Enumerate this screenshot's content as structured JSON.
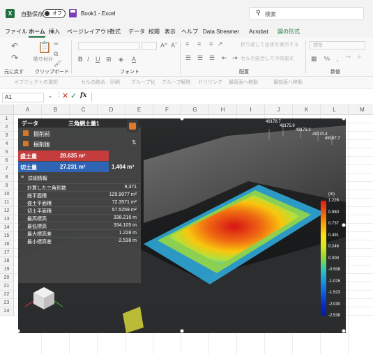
{
  "title_bar": {
    "autosave_label": "自動保存",
    "autosave_state": "オフ",
    "book_title": "Book1 - Excel",
    "search_placeholder": "検索"
  },
  "menu_tabs": [
    "ファイル",
    "ホーム",
    "挿入",
    "ページレイアウト",
    "数式",
    "データ",
    "校閲",
    "表示",
    "ヘルプ",
    "Data Streamer",
    "Acrobat",
    "図の形式"
  ],
  "active_tab": "ホーム",
  "ribbon": {
    "groups": [
      "元に戻す",
      "クリップボード",
      "フォント",
      "配置",
      "数値"
    ],
    "paste_label": "貼り付け",
    "wrap_text": "折り返して全体を表示する",
    "merge_center": "セルを結合して中央揃え",
    "number_format": "標準",
    "font_buttons": [
      "B",
      "I",
      "U"
    ],
    "font_grow": "A^",
    "font_shrink": "Aˇ"
  },
  "qat_items": [
    "オブジェクトの選択",
    "セルの結合",
    "印刷",
    "グループ化",
    "グループ解除",
    "ドリリング",
    "最背面へ移動",
    "最前面へ移動"
  ],
  "formula_bar": {
    "name_box": "A1",
    "fx": "fx"
  },
  "columns": [
    "A",
    "B",
    "C",
    "D",
    "E",
    "F",
    "G",
    "H",
    "I",
    "J",
    "K",
    "L",
    "M"
  ],
  "rows": [
    "1",
    "2",
    "3",
    "4",
    "5",
    "6",
    "7",
    "8",
    "9",
    "10",
    "11",
    "12",
    "13",
    "14",
    "15",
    "16",
    "17",
    "18",
    "19",
    "20",
    "21",
    "22",
    "23",
    "24"
  ],
  "panel": {
    "header_label": "データ",
    "tab_name": "三角網土量1",
    "before_label": "掘削前",
    "after_label": "掘削後",
    "fill_label": "盛土量",
    "fill_value": "28.635 m³",
    "cut_label": "切土量",
    "cut_value": "27.231 m³",
    "net_value": "1.404 m³",
    "detail_title": "詳細情報",
    "details": [
      {
        "k": "計算した三角形数",
        "v": "9,371"
      },
      {
        "k": "総平面積",
        "v": "129.9077 m²"
      },
      {
        "k": "盛土平面積",
        "v": "72.3571 m²"
      },
      {
        "k": "切土平面積",
        "v": "57.5259 m²"
      },
      {
        "k": "最高標高",
        "v": "338.216 m"
      },
      {
        "k": "最低標高",
        "v": "334.105 m"
      },
      {
        "k": "最大標高差",
        "v": "1.228 m"
      },
      {
        "k": "最小標高差",
        "v": "-2.538 m"
      }
    ]
  },
  "colorbar": {
    "unit": "(m)",
    "labels": [
      "1.228",
      "0.980",
      "0.737",
      "0.491",
      "0.246",
      "0.000",
      "-0.508",
      "-1.015",
      "-1.523",
      "-2.030",
      "-2.538"
    ],
    "colors": [
      "#e01818",
      "#ee5a12",
      "#f7a20b",
      "#fbe214",
      "#d8ea18",
      "#8fd63a",
      "#2fc8ba",
      "#1a96e0",
      "#1060d8",
      "#0a2ec8",
      "#071a9e"
    ]
  },
  "elevation_labels": [
    "49178.7",
    "49175.9",
    "49173.2",
    "49170.4",
    "49167.7"
  ]
}
